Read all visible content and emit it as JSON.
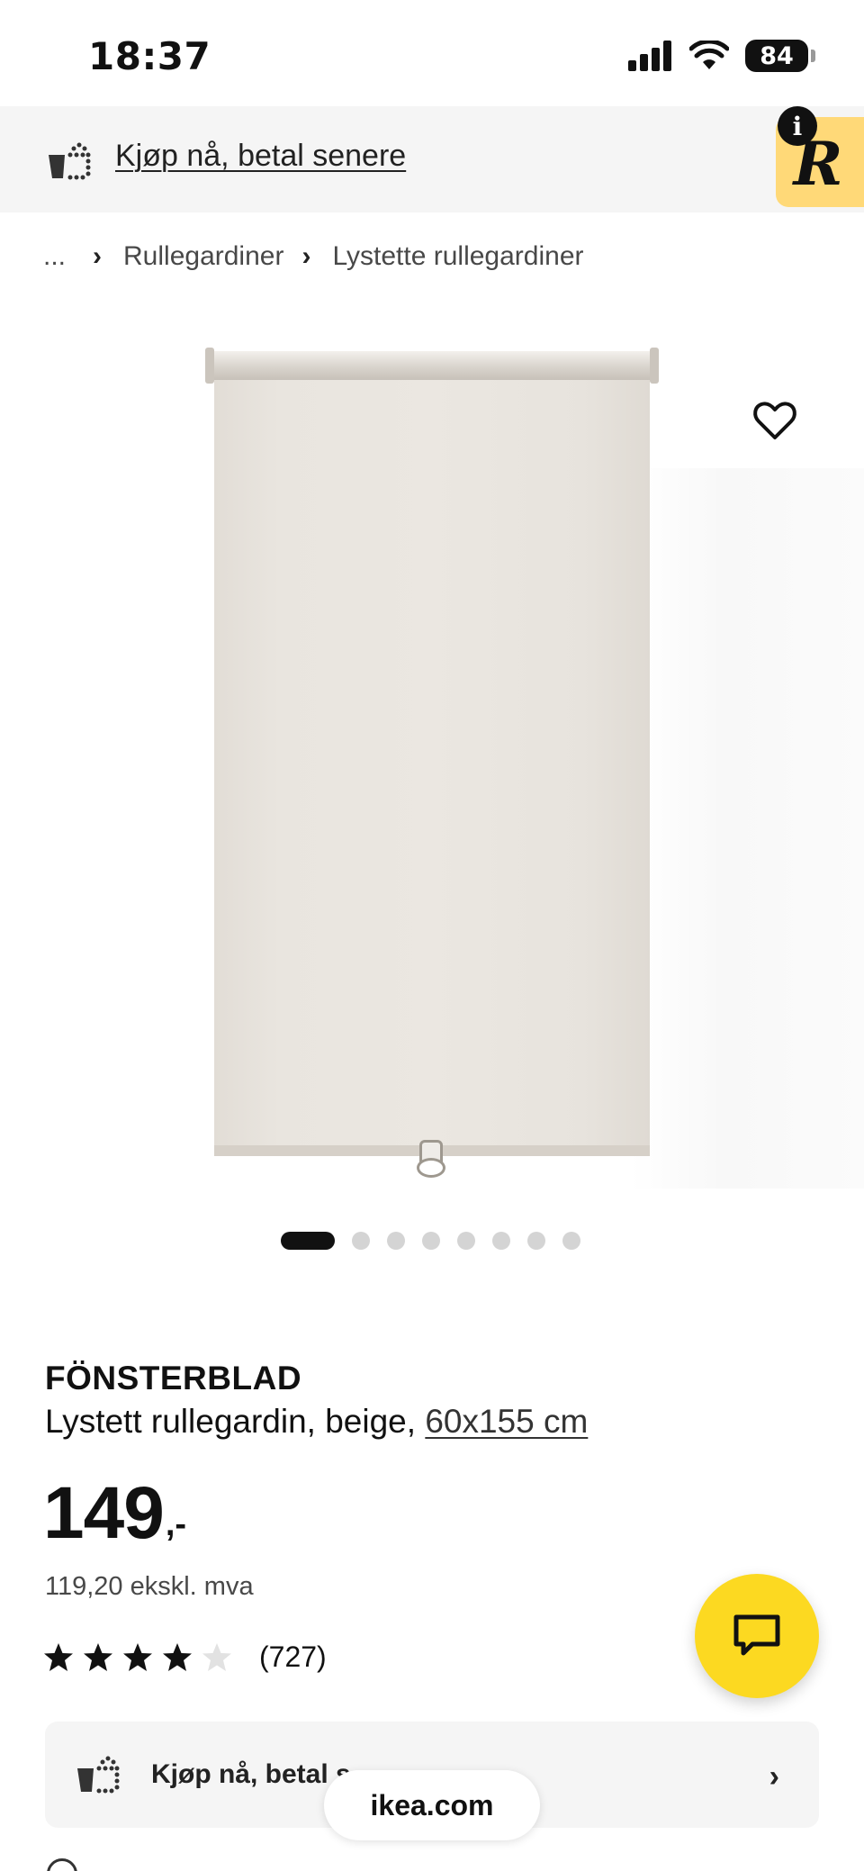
{
  "status_bar": {
    "time": "18:37",
    "battery": "84",
    "icons": [
      "cellular-signal-icon",
      "wifi-icon",
      "battery-icon"
    ]
  },
  "promo_banner": {
    "link_text": "Kjøp nå, betal senere",
    "icon": "basket-dotted-icon",
    "badge_letter": "R",
    "info_letter": "i",
    "badge_color": "#ffd978"
  },
  "breadcrumb": {
    "ellipsis": "...",
    "items": [
      "Rullegardiner",
      "Lystette rullegardiner"
    ]
  },
  "product": {
    "name": "FÖNSTERBLAD",
    "description": "Lystett rullegardin, beige,",
    "size": "60x155 cm",
    "price_main": "149",
    "price_suffix": ",-",
    "price_ex_vat": "119,20 ekskl. mva",
    "rating": {
      "stars_filled": 4,
      "stars_total": 5,
      "count": "(727)"
    }
  },
  "carousel": {
    "total": 8,
    "active_index": 0
  },
  "pay_card": {
    "label": "Kjøp nå, betal s",
    "icon": "basket-dotted-icon"
  },
  "url_pill": {
    "text": "ikea.com"
  },
  "colors": {
    "accent_yellow": "#fcd921",
    "text_primary": "#111111",
    "banner_bg": "#f5f5f5"
  }
}
